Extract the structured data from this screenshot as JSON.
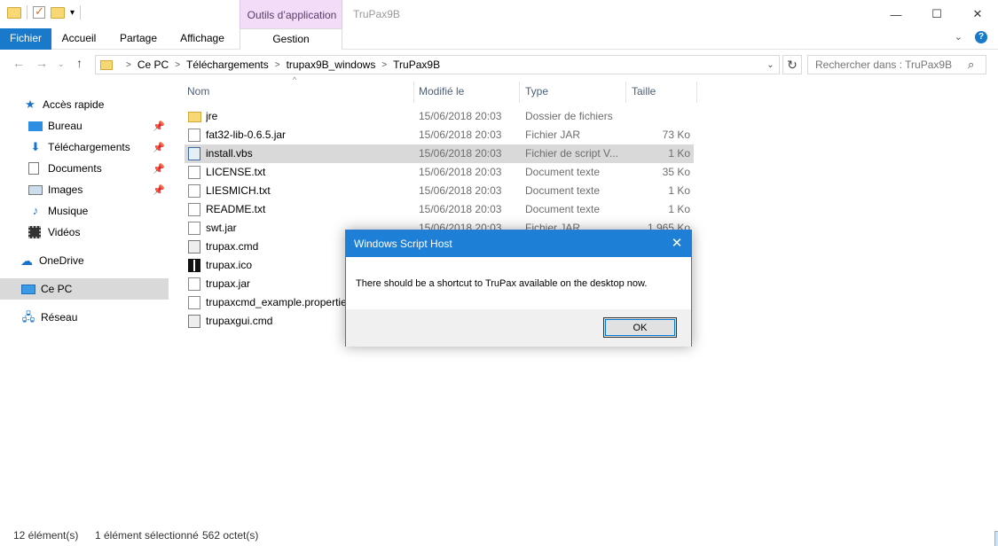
{
  "window": {
    "title": "TruPax9B",
    "contextual_tab_group": "Outils d’application",
    "controls": {
      "minimize": "—",
      "maximize": "☐",
      "close": "✕"
    }
  },
  "ribbon": {
    "tabs": [
      "Fichier",
      "Accueil",
      "Partage",
      "Affichage",
      "Gestion"
    ]
  },
  "address": {
    "crumbs": [
      "Ce PC",
      "Téléchargements",
      "trupax9B_windows",
      "TruPax9B"
    ],
    "search_placeholder": "Rechercher dans : TruPax9B"
  },
  "sidebar": {
    "items": [
      {
        "label": "Accès rapide",
        "icon": "star-icon",
        "pinned": false
      },
      {
        "label": "Bureau",
        "icon": "desktop-icon",
        "pinned": true
      },
      {
        "label": "Téléchargements",
        "icon": "download-icon",
        "pinned": true
      },
      {
        "label": "Documents",
        "icon": "documents-icon",
        "pinned": true
      },
      {
        "label": "Images",
        "icon": "images-icon",
        "pinned": true
      },
      {
        "label": "Musique",
        "icon": "music-icon",
        "pinned": false
      },
      {
        "label": "Vidéos",
        "icon": "videos-icon",
        "pinned": false
      },
      {
        "label": "OneDrive",
        "icon": "cloud-icon",
        "pinned": false
      },
      {
        "label": "Ce PC",
        "icon": "pc-icon",
        "pinned": false,
        "selected": true
      },
      {
        "label": "Réseau",
        "icon": "network-icon",
        "pinned": false
      }
    ]
  },
  "filelist": {
    "columns": {
      "name": "Nom",
      "modified": "Modifié le",
      "type": "Type",
      "size": "Taille"
    },
    "rows": [
      {
        "name": "jre",
        "modified": "15/06/2018 20:03",
        "type": "Dossier de fichiers",
        "size": "",
        "icon": "folder-icon"
      },
      {
        "name": "fat32-lib-0.6.5.jar",
        "modified": "15/06/2018 20:03",
        "type": "Fichier JAR",
        "size": "73 Ko",
        "icon": "file-icon"
      },
      {
        "name": "install.vbs",
        "modified": "15/06/2018 20:03",
        "type": "Fichier de script V...",
        "size": "1 Ko",
        "icon": "script-icon",
        "selected": true
      },
      {
        "name": "LICENSE.txt",
        "modified": "15/06/2018 20:03",
        "type": "Document texte",
        "size": "35 Ko",
        "icon": "text-file-icon"
      },
      {
        "name": "LIESMICH.txt",
        "modified": "15/06/2018 20:03",
        "type": "Document texte",
        "size": "1 Ko",
        "icon": "text-file-icon"
      },
      {
        "name": "README.txt",
        "modified": "15/06/2018 20:03",
        "type": "Document texte",
        "size": "1 Ko",
        "icon": "text-file-icon"
      },
      {
        "name": "swt.jar",
        "modified": "15/06/2018 20:03",
        "type": "Fichier JAR",
        "size": "1 965 Ko",
        "icon": "file-icon"
      },
      {
        "name": "trupax.cmd",
        "modified": "",
        "type": "",
        "size": "",
        "icon": "cmd-icon"
      },
      {
        "name": "trupax.ico",
        "modified": "",
        "type": "",
        "size": "",
        "icon": "ico-icon"
      },
      {
        "name": "trupax.jar",
        "modified": "",
        "type": "",
        "size": "",
        "icon": "file-icon"
      },
      {
        "name": "trupaxcmd_example.properties",
        "modified": "",
        "type": "",
        "size": "",
        "icon": "file-icon"
      },
      {
        "name": "trupaxgui.cmd",
        "modified": "",
        "type": "",
        "size": "",
        "icon": "cmd-icon"
      }
    ]
  },
  "status": {
    "count": "12 élément(s)",
    "selection": "1 élément sélectionné",
    "size": "562 octet(s)"
  },
  "dialog": {
    "title": "Windows Script Host",
    "message": "There should be a shortcut to TruPax available on the desktop now.",
    "ok_label": "OK"
  }
}
